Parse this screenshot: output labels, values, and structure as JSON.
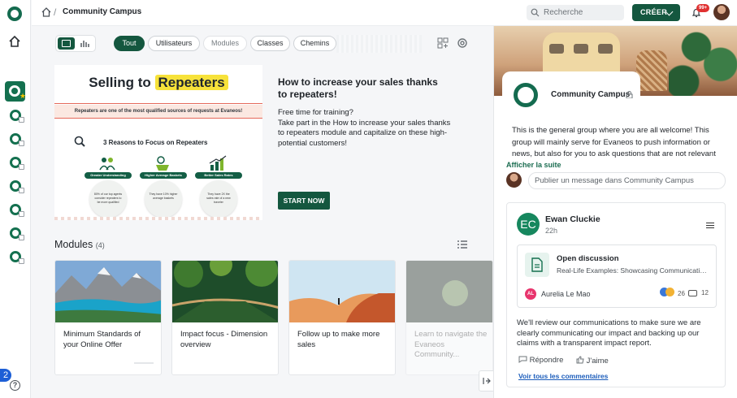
{
  "topbar": {
    "title": "Community Campus",
    "separator": "/",
    "search_placeholder": "Recherche",
    "create_label": "CRÉER",
    "notif_badge": "99+"
  },
  "rail": {
    "badge": "2",
    "help": "?"
  },
  "filters": {
    "items": [
      "Tout",
      "Utilisateurs",
      "Modules",
      "Classes",
      "Chemins"
    ],
    "active": "Tout"
  },
  "banner": {
    "title_pre": "Selling to ",
    "title_hl": "Repeaters",
    "subtitle": "Repeaters are one of the most qualified sources of requests at Evaneos!",
    "reasons_title": "3 Reasons to Focus on Repeaters",
    "reasons": [
      {
        "tag": "Greater Understanding",
        "text": "80% of our top agents consider repeaters to be more qualified"
      },
      {
        "tag": "Higher Average Baskets",
        "text": "They have 10% higher average baskets"
      },
      {
        "tag": "Better Sales Rates",
        "text": "They have 2X the sales rate of a new traveler"
      }
    ]
  },
  "featured": {
    "title": "How to increase your sales thanks to repeaters!",
    "description_1": "Free time for training?",
    "description_2": "Take part in the How to increase your sales thanks to repeaters module and capitalize on these high-potential customers!",
    "cta": "START NOW"
  },
  "modules": {
    "title": "Modules",
    "count": "(4)",
    "cards": [
      {
        "title": "Minimum Standards of your Online Offer"
      },
      {
        "title": "Impact focus - Dimension overview"
      },
      {
        "title": "Follow up to make more sales"
      },
      {
        "title": "Learn to navigate the Evaneos Community..."
      }
    ]
  },
  "group": {
    "name": "Community Campus",
    "about": "This is the general group where you are all welcome! This group will mainly serve for Evaneos to push information or news, but also for you to ask questions that are not relevant in",
    "show_more": "Afficher la suite",
    "compose_placeholder": "Publier un message dans Community Campus"
  },
  "post": {
    "author_initials": "EC",
    "author": "Ewan Cluckie",
    "time": "22h",
    "embed_title": "Open discussion",
    "embed_subtitle": "Real-Life Examples: Showcasing Communication...",
    "embed_author_initials": "AL",
    "embed_author": "Aurelia Le Mao",
    "reactions": "26",
    "comments": "12",
    "body": "We'll review our communications to make sure we are clearly communicating our impact and backing up our claims with a transparent impact report.",
    "reply": "Répondre",
    "like": "J'aime",
    "see_all": "Voir tous les commentaires"
  },
  "colors": {
    "brand_green": "#14573f",
    "accent_green": "#146b4f",
    "badge_blue": "#1d5fd6",
    "notif_red": "#e03131"
  },
  "icons": [
    "home-icon",
    "search-icon",
    "bell-icon",
    "grid-view-icon",
    "chart-view-icon",
    "add-icon",
    "settings-icon",
    "list-icon",
    "lock-icon",
    "document-icon",
    "comment-icon",
    "reply-icon",
    "like-icon",
    "collapse-icon",
    "help-icon"
  ]
}
